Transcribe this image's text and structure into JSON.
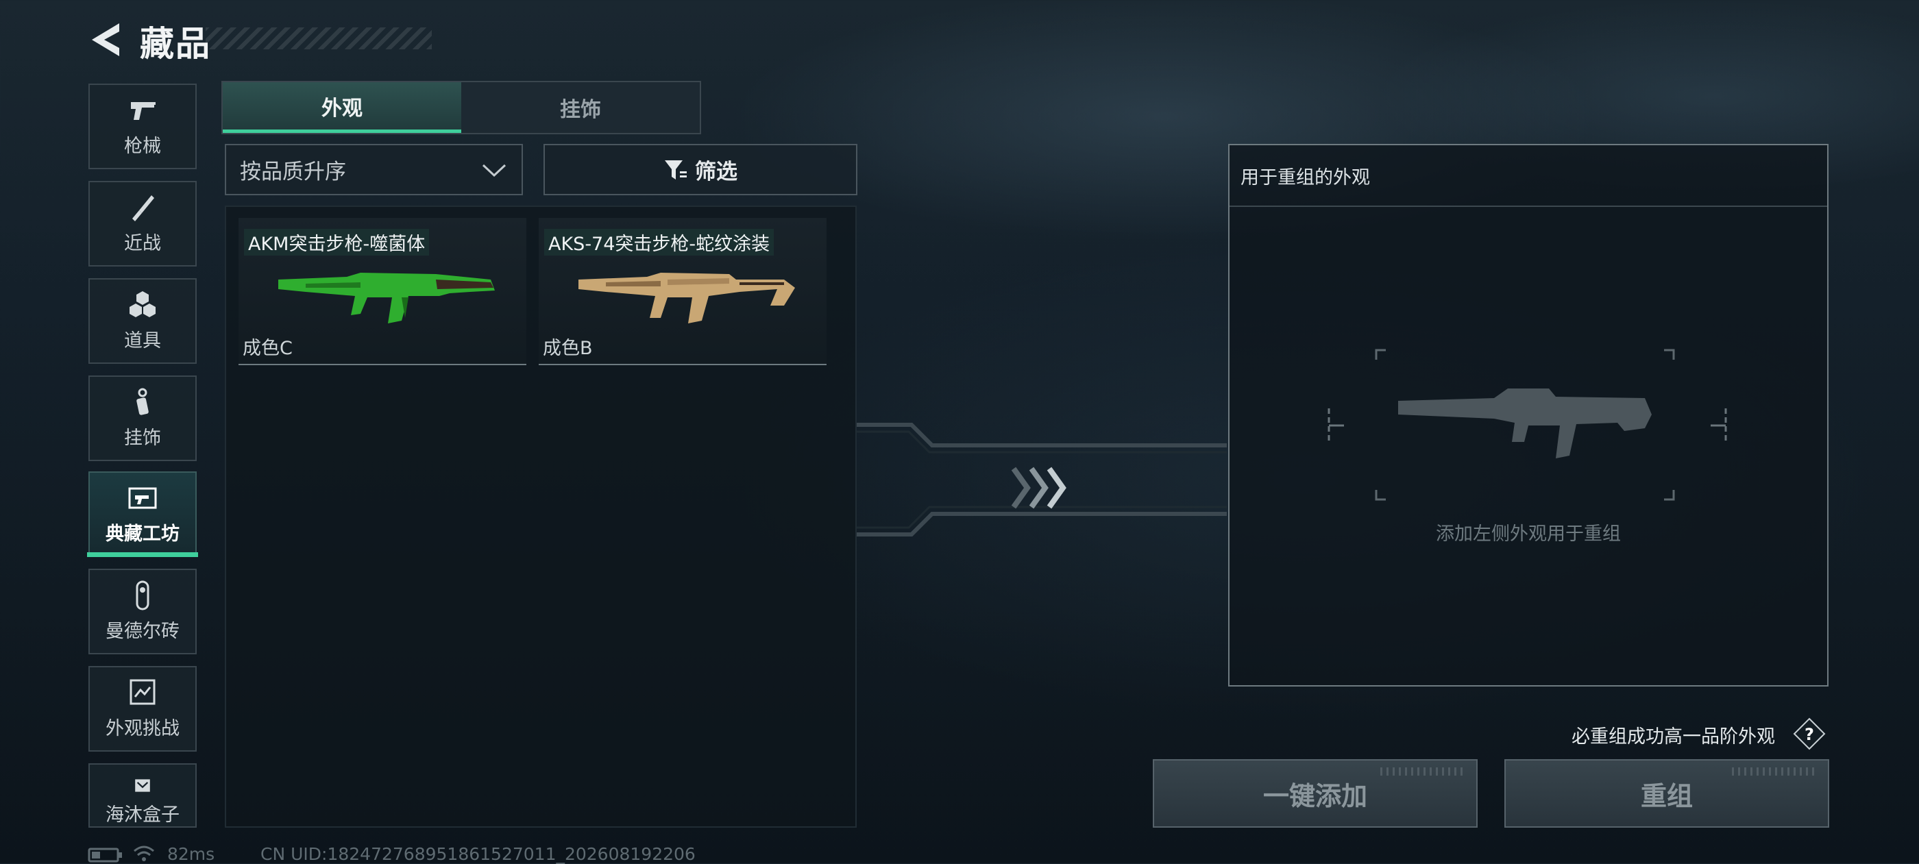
{
  "header": {
    "title": "藏品"
  },
  "sidebar": {
    "items": [
      {
        "label": "枪械",
        "icon": "pistol-icon"
      },
      {
        "label": "近战",
        "icon": "knife-icon"
      },
      {
        "label": "道具",
        "icon": "grenade-icon"
      },
      {
        "label": "挂饰",
        "icon": "charm-icon"
      },
      {
        "label": "典藏工坊",
        "icon": "workshop-icon",
        "active": true
      },
      {
        "label": "曼德尔砖",
        "icon": "brick-icon"
      },
      {
        "label": "外观挑战",
        "icon": "challenge-icon"
      },
      {
        "label": "海沐盒子",
        "icon": "box-icon"
      }
    ]
  },
  "tabs": [
    {
      "label": "外观",
      "active": true
    },
    {
      "label": "挂饰",
      "active": false
    }
  ],
  "sort": {
    "label": "按品质升序"
  },
  "filter": {
    "label": "筛选"
  },
  "items": [
    {
      "name": "AKM突击步枪-噬菌体",
      "grade": "成色C",
      "color": "#2fae2f"
    },
    {
      "name": "AKS-74突击步枪-蛇纹涂装",
      "grade": "成色B",
      "color": "#c9a774"
    }
  ],
  "recompose": {
    "panel_title": "用于重组的外观",
    "placeholder": "添加左侧外观用于重组",
    "guarantee": "必重组成功高一品阶外观",
    "auto_add_label": "一键添加",
    "recompose_label": "重组"
  },
  "status": {
    "ping": "82ms",
    "uid": "CN UID:1824727689518615270​11_202608192206"
  },
  "colors": {
    "accent": "#3fcf9c"
  }
}
